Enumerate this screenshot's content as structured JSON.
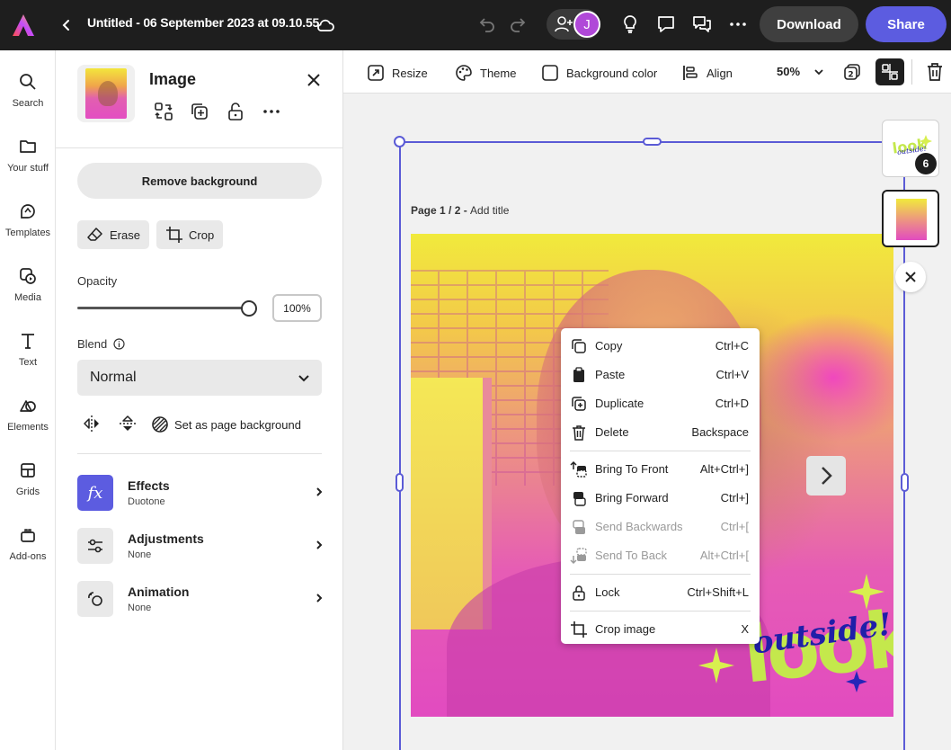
{
  "app": {
    "doc_title": "Untitled - 06 September 2023 at 09.10.55",
    "avatar_initial": "J",
    "download_label": "Download",
    "share_label": "Share"
  },
  "rail": {
    "items": [
      {
        "label": "Search",
        "icon": "search-icon"
      },
      {
        "label": "Your stuff",
        "icon": "folder-icon"
      },
      {
        "label": "Templates",
        "icon": "templates-icon"
      },
      {
        "label": "Media",
        "icon": "media-icon"
      },
      {
        "label": "Text",
        "icon": "text-icon"
      },
      {
        "label": "Elements",
        "icon": "elements-icon"
      },
      {
        "label": "Grids",
        "icon": "grid-icon"
      },
      {
        "label": "Add-ons",
        "icon": "addons-icon"
      }
    ]
  },
  "panel": {
    "title": "Image",
    "remove_bg_label": "Remove background",
    "erase_label": "Erase",
    "crop_label": "Crop",
    "opacity_label": "Opacity",
    "opacity_value": "100%",
    "opacity_level": 1.0,
    "blend_label": "Blend",
    "blend_value": "Normal",
    "set_page_bg_label": "Set as page background",
    "rows": [
      {
        "title": "Effects",
        "subtitle": "Duotone",
        "icon": "fx-icon"
      },
      {
        "title": "Adjustments",
        "subtitle": "None",
        "icon": "sliders-icon"
      },
      {
        "title": "Animation",
        "subtitle": "None",
        "icon": "animation-icon"
      }
    ]
  },
  "toolbar": {
    "resize_label": "Resize",
    "theme_label": "Theme",
    "bg_color_label": "Background color",
    "align_label": "Align",
    "zoom": "50%",
    "layers_count": "2"
  },
  "canvas": {
    "page_prefix": "Page 1 / 2 - ",
    "page_title_placeholder": "Add title",
    "sticker_line1": "look",
    "sticker_line2": "outside!",
    "thumb_badge": "6"
  },
  "context_menu": {
    "items": [
      {
        "label": "Copy",
        "shortcut": "Ctrl+C",
        "icon": "copy-icon",
        "enabled": true
      },
      {
        "label": "Paste",
        "shortcut": "Ctrl+V",
        "icon": "paste-icon",
        "enabled": true
      },
      {
        "label": "Duplicate",
        "shortcut": "Ctrl+D",
        "icon": "duplicate-icon",
        "enabled": true
      },
      {
        "label": "Delete",
        "shortcut": "Backspace",
        "icon": "trash-icon",
        "enabled": true
      },
      {
        "label": "Bring To Front",
        "shortcut": "Alt+Ctrl+]",
        "icon": "bring-front-icon",
        "enabled": true
      },
      {
        "label": "Bring Forward",
        "shortcut": "Ctrl+]",
        "icon": "bring-forward-icon",
        "enabled": true
      },
      {
        "label": "Send Backwards",
        "shortcut": "Ctrl+[",
        "icon": "send-backward-icon",
        "enabled": false
      },
      {
        "label": "Send To Back",
        "shortcut": "Alt+Ctrl+[",
        "icon": "send-back-icon",
        "enabled": false
      },
      {
        "label": "Lock",
        "shortcut": "Ctrl+Shift+L",
        "icon": "lock-icon",
        "enabled": true
      },
      {
        "label": "Crop image",
        "shortcut": "X",
        "icon": "crop-icon",
        "enabled": true
      }
    ]
  },
  "colors": {
    "accent": "#5c5ce0",
    "topbar": "#1e1e1e",
    "selection": "#5b5bd6"
  }
}
